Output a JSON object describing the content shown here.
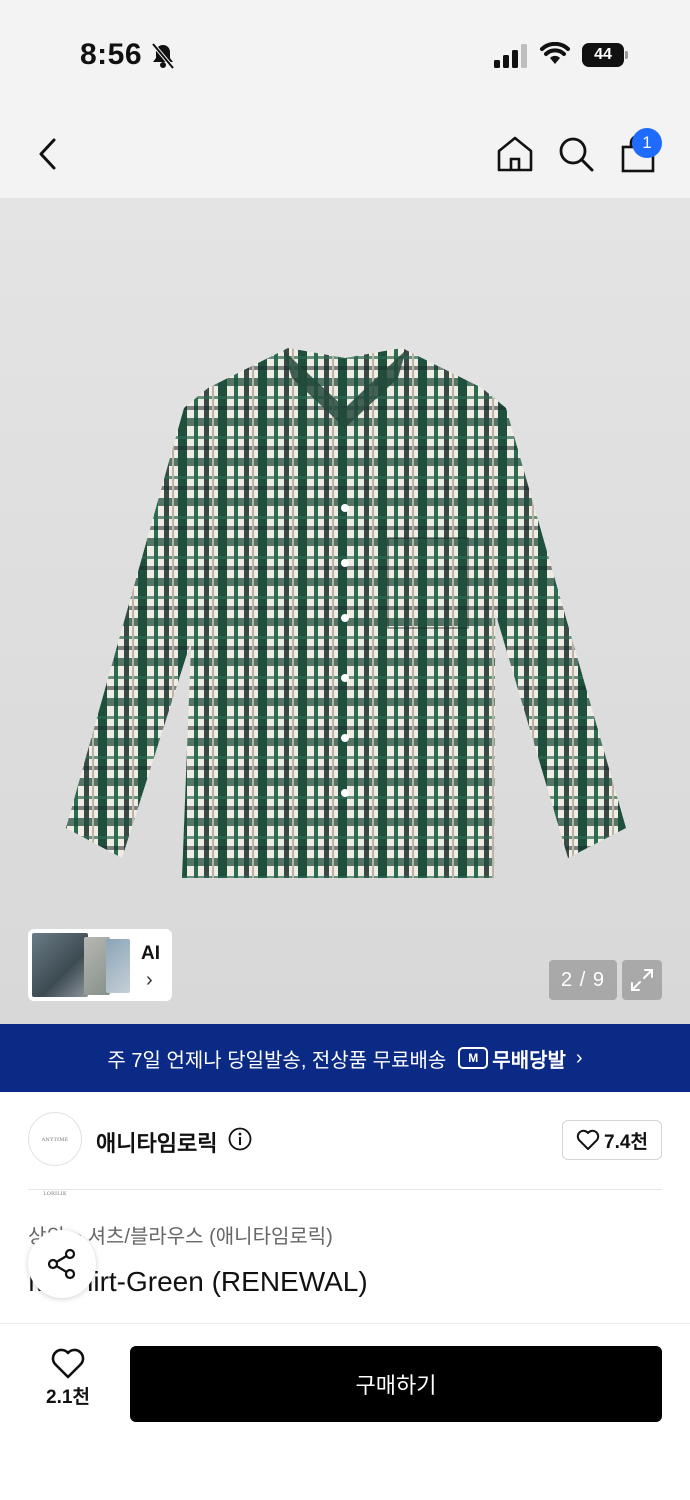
{
  "status_bar": {
    "time": "8:56",
    "battery": "44"
  },
  "nav": {
    "cart_count": "1"
  },
  "gallery": {
    "ai_label": "AI",
    "ai_chevron": "›",
    "counter": "2 / 9"
  },
  "promo": {
    "text": "주 7일 언제나 당일발송, 전상품 무료배송",
    "logo_mark": "M",
    "logo_text": "무배당발",
    "chevron": "›"
  },
  "brand": {
    "logo_text": "ANYTIME LORILIK",
    "name": "애니타임로릭",
    "like_count": "7.4천"
  },
  "product": {
    "breadcrumb": "상의  >  셔츠/블라우스 (애니타임로릭)",
    "title": "M Shirt-Green (RENEWAL)"
  },
  "bottom_bar": {
    "wish_count": "2.1천",
    "buy_label": "구매하기"
  },
  "colors": {
    "promo_bg": "#0b2a85",
    "badge": "#1f6bff",
    "buy_bg": "#000000"
  }
}
